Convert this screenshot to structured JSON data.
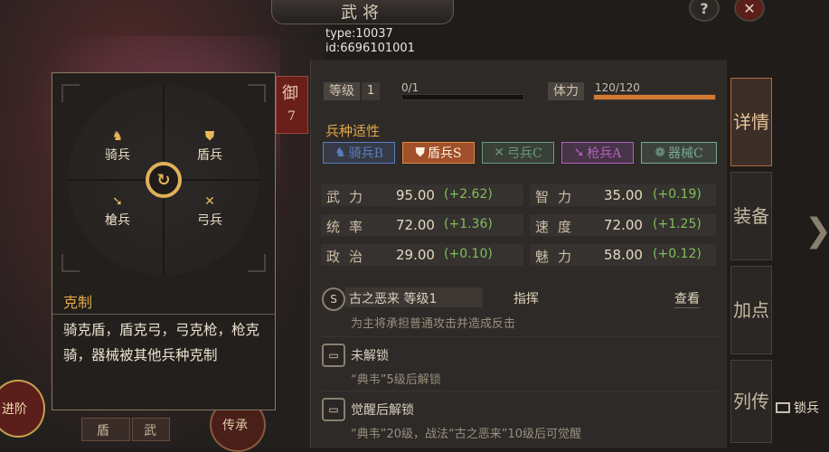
{
  "header": {
    "title": "武将",
    "help_icon": "?",
    "close_icon": "✕",
    "type_text": "type:10037",
    "id_text": "id:6696101001"
  },
  "level": {
    "label": "等级",
    "value": "1",
    "progress_text": "0/1",
    "progress": 0.0
  },
  "stamina": {
    "label": "体力",
    "value_text": "120/120",
    "progress": 1.0
  },
  "unit_affinity": {
    "title": "兵种适性",
    "items": [
      {
        "icon": "horse-icon",
        "label": "骑兵B",
        "color": "#5a7fc0"
      },
      {
        "icon": "shield-icon",
        "label": "盾兵S",
        "color": "#e08a40"
      },
      {
        "icon": "bow-icon",
        "label": "弓兵C",
        "color": "#6a9a78"
      },
      {
        "icon": "spear-icon",
        "label": "枪兵A",
        "color": "#b060c0"
      },
      {
        "icon": "machine-icon",
        "label": "器械C",
        "color": "#7aa890"
      }
    ]
  },
  "stats": [
    {
      "name": "武力",
      "value": "95.00",
      "bonus": "(+2.62)"
    },
    {
      "name": "智力",
      "value": "35.00",
      "bonus": "(+0.19)"
    },
    {
      "name": "统率",
      "value": "72.00",
      "bonus": "(+1.36)"
    },
    {
      "name": "速度",
      "value": "72.00",
      "bonus": "(+1.25)"
    },
    {
      "name": "政治",
      "value": "29.00",
      "bonus": "(+0.10)"
    },
    {
      "name": "魅力",
      "value": "58.00",
      "bonus": "(+0.12)"
    }
  ],
  "skills": [
    {
      "badge": "S",
      "name": "古之恶来 等级1",
      "type": "指挥",
      "action": "查看",
      "desc": "为主将承担普通攻击并造成反击"
    },
    {
      "badge": "▭",
      "name": "未解锁",
      "desc": "“典韦”5级后解锁"
    },
    {
      "badge": "▭",
      "name": "觉醒后解锁",
      "desc": "“典韦”20级，战法“古之恶来”10级后可觉醒"
    }
  ],
  "side_tabs": [
    "详情",
    "装备",
    "加点",
    "列传"
  ],
  "popup": {
    "wheel": {
      "cavalry": "骑兵",
      "shield": "盾兵",
      "spear": "槍兵",
      "archer": "弓兵"
    },
    "heading": "克制",
    "text": "骑克盾，盾克弓，弓克枪，枪克骑，器械被其他兵种克制"
  },
  "left_panel": {
    "defense_tag": "御",
    "defense_value": "7",
    "advance_label": "进阶",
    "bottom_tags": [
      "盾",
      "武"
    ],
    "heritage_label": "传承"
  },
  "lock_label": "锁兵",
  "next_arrow": "❯"
}
